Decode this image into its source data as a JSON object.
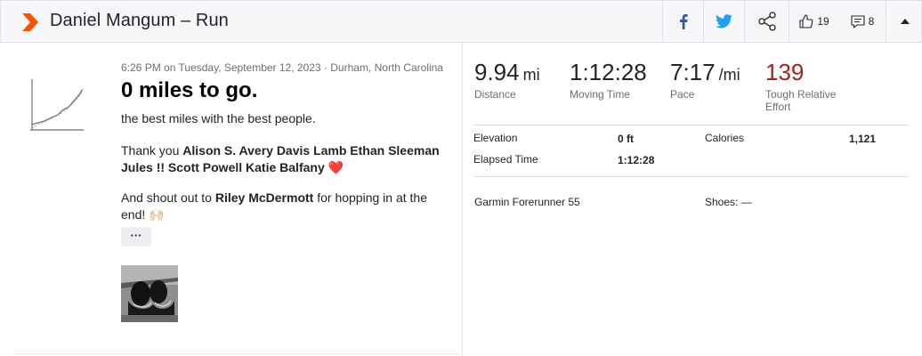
{
  "header": {
    "title": "Daniel Mangum – Run",
    "kudos_count": "19",
    "comment_count": "8",
    "icons": [
      "strava-logo-icon",
      "facebook-icon",
      "twitter-icon",
      "share-icon",
      "thumbs-up-icon",
      "comment-icon",
      "caret-up-icon"
    ],
    "colors": {
      "brand": "#fc5200",
      "facebook": "#3b5998",
      "twitter": "#1da1f2",
      "relative_effort": "#a0241e"
    }
  },
  "activity": {
    "meta": "6:26 PM on Tuesday, September 12, 2023 · Durham, North Carolina",
    "name": "0 miles to go.",
    "description_line1": "the best miles with the best people.",
    "thank_prefix": "Thank you ",
    "thanked": "Alison S. Avery Davis Lamb Ethan Sleeman Jules !! Scott Powell Katie Balfany",
    "heart": "❤️",
    "shout_prefix": "And shout out to ",
    "shout_name": "Riley McDermott",
    "shout_suffix": " for hopping in at the end! 🙌🏻",
    "more_label": "···"
  },
  "stats": {
    "distance": {
      "value": "9.94",
      "unit": "mi",
      "label": "Distance"
    },
    "moving_time": {
      "value": "1:12:28",
      "label": "Moving Time"
    },
    "pace": {
      "value": "7:17",
      "unit": "/mi",
      "label": "Pace"
    },
    "relative_effort": {
      "value": "139",
      "label": "Tough Relative Effort"
    }
  },
  "more_stats": {
    "elevation": {
      "label": "Elevation",
      "value": "0 ft"
    },
    "calories": {
      "label": "Calories",
      "value": "1,121"
    },
    "elapsed_time": {
      "label": "Elapsed Time",
      "value": "1:12:28"
    },
    "device": "Garmin Forerunner 55",
    "shoes": "Shoes: —"
  }
}
